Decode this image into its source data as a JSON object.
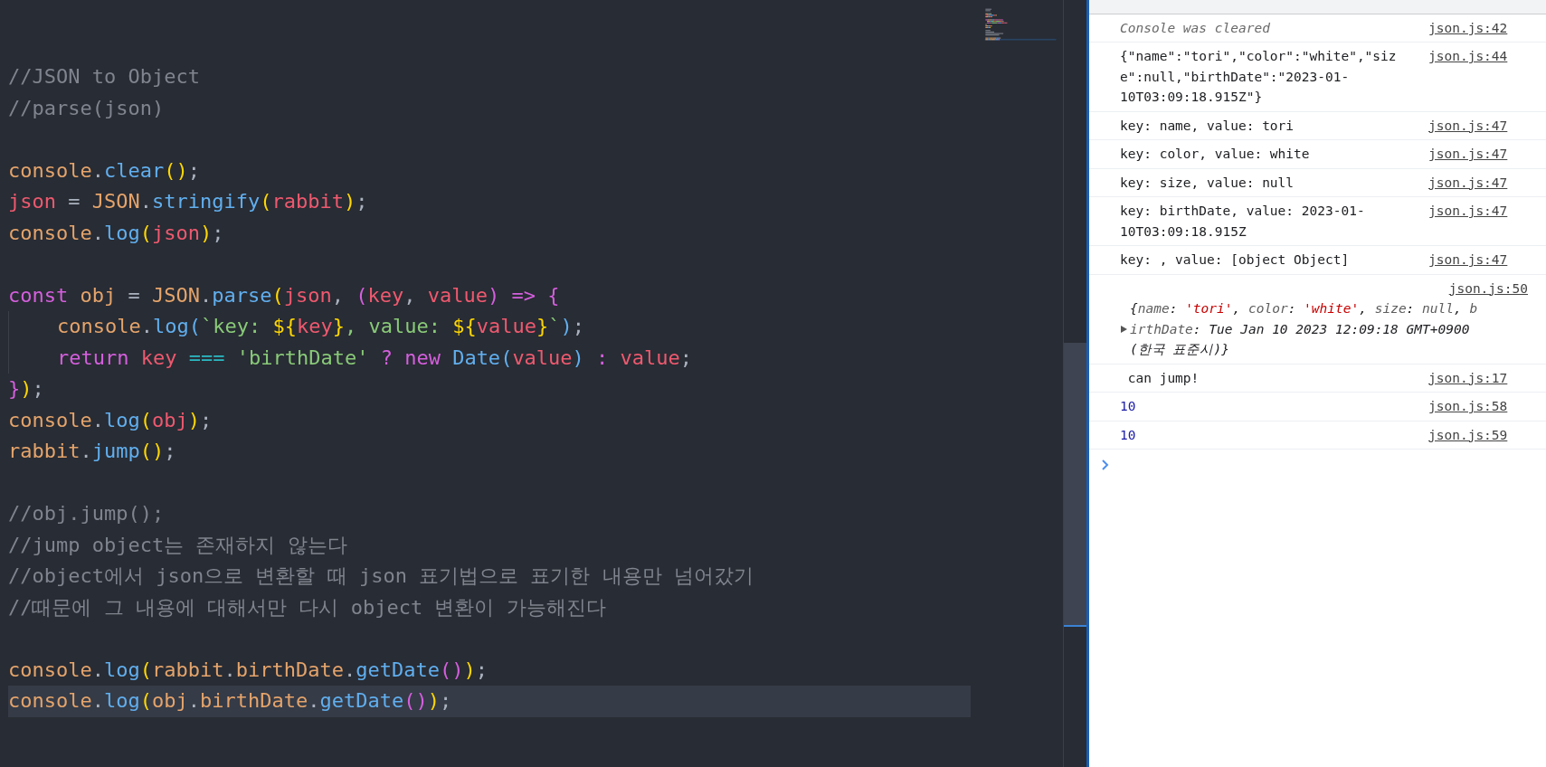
{
  "editor": {
    "lines": [
      {
        "kind": "code",
        "current": false,
        "tokens": [
          {
            "text": "//JSON to Object",
            "kind": "comment"
          }
        ]
      },
      {
        "kind": "code",
        "current": false,
        "tokens": [
          {
            "text": "//parse(json)",
            "kind": "comment"
          }
        ]
      },
      {
        "kind": "blank",
        "current": false
      },
      {
        "kind": "code",
        "current": false,
        "tokens": [
          {
            "text": "console",
            "kind": "object"
          },
          {
            "text": ".",
            "kind": "plain"
          },
          {
            "text": "clear",
            "kind": "function"
          },
          {
            "text": "()",
            "kind": "paren"
          },
          {
            "text": ";",
            "kind": "plain"
          }
        ]
      },
      {
        "kind": "code",
        "current": false,
        "tokens": [
          {
            "text": "json",
            "kind": "variable"
          },
          {
            "text": " = ",
            "kind": "plain"
          },
          {
            "text": "JSON",
            "kind": "object"
          },
          {
            "text": ".",
            "kind": "plain"
          },
          {
            "text": "stringify",
            "kind": "function"
          },
          {
            "text": "(",
            "kind": "paren"
          },
          {
            "text": "rabbit",
            "kind": "variable"
          },
          {
            "text": ")",
            "kind": "paren"
          },
          {
            "text": ";",
            "kind": "plain"
          }
        ]
      },
      {
        "kind": "code",
        "current": false,
        "tokens": [
          {
            "text": "console",
            "kind": "object"
          },
          {
            "text": ".",
            "kind": "plain"
          },
          {
            "text": "log",
            "kind": "function"
          },
          {
            "text": "(",
            "kind": "paren"
          },
          {
            "text": "json",
            "kind": "variable"
          },
          {
            "text": ")",
            "kind": "paren"
          },
          {
            "text": ";",
            "kind": "plain"
          }
        ]
      },
      {
        "kind": "blank",
        "current": false
      },
      {
        "kind": "code",
        "current": false,
        "tokens": [
          {
            "text": "const",
            "kind": "keyword"
          },
          {
            "text": " obj",
            "kind": "object"
          },
          {
            "text": " = ",
            "kind": "plain"
          },
          {
            "text": "JSON",
            "kind": "object"
          },
          {
            "text": ".",
            "kind": "plain"
          },
          {
            "text": "parse",
            "kind": "function"
          },
          {
            "text": "(",
            "kind": "paren"
          },
          {
            "text": "json",
            "kind": "variable"
          },
          {
            "text": ",",
            "kind": "plain"
          },
          {
            "text": " (",
            "kind": "keyword"
          },
          {
            "text": "key",
            "kind": "variable"
          },
          {
            "text": ",",
            "kind": "plain"
          },
          {
            "text": " value",
            "kind": "variable"
          },
          {
            "text": ")",
            "kind": "keyword"
          },
          {
            "text": " =>",
            "kind": "keyword"
          },
          {
            "text": " {",
            "kind": "keyword"
          }
        ]
      },
      {
        "kind": "indented",
        "current": false,
        "tokens": [
          {
            "text": "console",
            "kind": "object"
          },
          {
            "text": ".",
            "kind": "plain"
          },
          {
            "text": "log",
            "kind": "function"
          },
          {
            "text": "(",
            "kind": "function"
          },
          {
            "text": "`key: ",
            "kind": "string"
          },
          {
            "text": "${",
            "kind": "paren"
          },
          {
            "text": "key",
            "kind": "variable"
          },
          {
            "text": "}",
            "kind": "paren"
          },
          {
            "text": ", value: ",
            "kind": "string"
          },
          {
            "text": "${",
            "kind": "paren"
          },
          {
            "text": "value",
            "kind": "variable"
          },
          {
            "text": "}",
            "kind": "paren"
          },
          {
            "text": "`",
            "kind": "string"
          },
          {
            "text": ")",
            "kind": "function"
          },
          {
            "text": ";",
            "kind": "plain"
          }
        ]
      },
      {
        "kind": "indented",
        "current": false,
        "tokens": [
          {
            "text": "return",
            "kind": "keyword"
          },
          {
            "text": " key",
            "kind": "variable"
          },
          {
            "text": " ===",
            "kind": "operator"
          },
          {
            "text": " 'birthDate'",
            "kind": "string"
          },
          {
            "text": " ?",
            "kind": "keyword"
          },
          {
            "text": " new",
            "kind": "keyword"
          },
          {
            "text": " Date",
            "kind": "function"
          },
          {
            "text": "(",
            "kind": "function"
          },
          {
            "text": "value",
            "kind": "variable"
          },
          {
            "text": ")",
            "kind": "function"
          },
          {
            "text": " :",
            "kind": "keyword"
          },
          {
            "text": " value",
            "kind": "variable"
          },
          {
            "text": ";",
            "kind": "plain"
          }
        ]
      },
      {
        "kind": "code",
        "current": false,
        "tokens": [
          {
            "text": "}",
            "kind": "keyword"
          },
          {
            "text": ")",
            "kind": "paren"
          },
          {
            "text": ";",
            "kind": "plain"
          }
        ]
      },
      {
        "kind": "code",
        "current": false,
        "tokens": [
          {
            "text": "console",
            "kind": "object"
          },
          {
            "text": ".",
            "kind": "plain"
          },
          {
            "text": "log",
            "kind": "function"
          },
          {
            "text": "(",
            "kind": "paren"
          },
          {
            "text": "obj",
            "kind": "variable"
          },
          {
            "text": ")",
            "kind": "paren"
          },
          {
            "text": ";",
            "kind": "plain"
          }
        ]
      },
      {
        "kind": "code",
        "current": false,
        "tokens": [
          {
            "text": "rabbit",
            "kind": "object"
          },
          {
            "text": ".",
            "kind": "plain"
          },
          {
            "text": "jump",
            "kind": "function"
          },
          {
            "text": "()",
            "kind": "paren"
          },
          {
            "text": ";",
            "kind": "plain"
          }
        ]
      },
      {
        "kind": "blank",
        "current": false
      },
      {
        "kind": "code",
        "current": false,
        "tokens": [
          {
            "text": "//obj.jump();",
            "kind": "comment"
          }
        ]
      },
      {
        "kind": "code",
        "current": false,
        "tokens": [
          {
            "text": "//jump object는 존재하지 않는다",
            "kind": "comment"
          }
        ]
      },
      {
        "kind": "code",
        "current": false,
        "tokens": [
          {
            "text": "//object에서 json으로 변환할 때 json 표기법으로 표기한 내용만 넘어갔기",
            "kind": "comment"
          }
        ]
      },
      {
        "kind": "code",
        "current": false,
        "tokens": [
          {
            "text": "//때문에 그 내용에 대해서만 다시 object 변환이 가능해진다",
            "kind": "comment"
          }
        ]
      },
      {
        "kind": "blank",
        "current": false
      },
      {
        "kind": "code",
        "current": false,
        "tokens": [
          {
            "text": "console",
            "kind": "object"
          },
          {
            "text": ".",
            "kind": "plain"
          },
          {
            "text": "log",
            "kind": "function"
          },
          {
            "text": "(",
            "kind": "paren"
          },
          {
            "text": "rabbit",
            "kind": "object"
          },
          {
            "text": ".",
            "kind": "plain"
          },
          {
            "text": "birthDate",
            "kind": "object"
          },
          {
            "text": ".",
            "kind": "plain"
          },
          {
            "text": "getDate",
            "kind": "function"
          },
          {
            "text": "()",
            "kind": "keyword"
          },
          {
            "text": ")",
            "kind": "paren"
          },
          {
            "text": ";",
            "kind": "plain"
          }
        ]
      },
      {
        "kind": "code",
        "current": true,
        "tokens": [
          {
            "text": "console",
            "kind": "object"
          },
          {
            "text": ".",
            "kind": "plain"
          },
          {
            "text": "log",
            "kind": "function"
          },
          {
            "text": "(",
            "kind": "paren"
          },
          {
            "text": "obj",
            "kind": "object"
          },
          {
            "text": ".",
            "kind": "plain"
          },
          {
            "text": "birthDate",
            "kind": "object"
          },
          {
            "text": ".",
            "kind": "plain"
          },
          {
            "text": "getDate",
            "kind": "function"
          },
          {
            "text": "()",
            "kind": "keyword"
          },
          {
            "text": ")",
            "kind": "paren"
          },
          {
            "text": ";",
            "kind": "plain"
          }
        ]
      }
    ]
  },
  "console": {
    "messages": [
      {
        "kind": "info",
        "text": "Console was cleared",
        "source": "json.js:42"
      },
      {
        "kind": "log",
        "text": "{\"name\":\"tori\",\"color\":\"white\",\"size\":null,\"birthDate\":\"2023-01-10T03:09:18.915Z\"}",
        "source": "json.js:44"
      },
      {
        "kind": "log",
        "text": "key: name, value: tori",
        "source": "json.js:47"
      },
      {
        "kind": "log",
        "text": "key: color, value: white",
        "source": "json.js:47"
      },
      {
        "kind": "log",
        "text": "key: size, value: null",
        "source": "json.js:47"
      },
      {
        "kind": "log",
        "text": "key: birthDate, value: 2023-01-10T03:09:18.915Z",
        "source": "json.js:47"
      },
      {
        "kind": "log",
        "text": "key: , value: [object Object]",
        "source": "json.js:47"
      },
      {
        "kind": "object",
        "source": "json.js:50",
        "tokens": [
          {
            "text": "{",
            "kind": "punct"
          },
          {
            "text": "name",
            "kind": "key"
          },
          {
            "text": ": ",
            "kind": "punct"
          },
          {
            "text": "'tori'",
            "kind": "string"
          },
          {
            "text": ", ",
            "kind": "punct"
          },
          {
            "text": "color",
            "kind": "key"
          },
          {
            "text": ": ",
            "kind": "punct"
          },
          {
            "text": "'white'",
            "kind": "string"
          },
          {
            "text": ", ",
            "kind": "punct"
          },
          {
            "text": "size",
            "kind": "key"
          },
          {
            "text": ": ",
            "kind": "punct"
          },
          {
            "text": "null",
            "kind": "key"
          },
          {
            "text": ", ",
            "kind": "punct"
          },
          {
            "text": "birthDate",
            "kind": "key"
          },
          {
            "text": ": Tue Jan 10 2023 12:09:18 GMT+0900 (한국 표준시)}",
            "kind": "punct"
          }
        ]
      },
      {
        "kind": "log",
        "text": " can jump!",
        "source": "json.js:17"
      },
      {
        "kind": "number",
        "text": "10",
        "source": "json.js:58"
      },
      {
        "kind": "number",
        "text": "10",
        "source": "json.js:59"
      }
    ]
  }
}
